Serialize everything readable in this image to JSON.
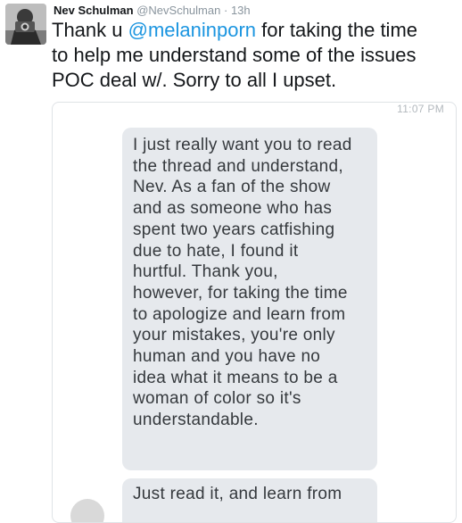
{
  "tweet": {
    "author_name": "Nev Schulman",
    "author_handle": "@NevSchulman",
    "separator": "·",
    "timestamp": "13h",
    "text_before_mention": "Thank u ",
    "mention": "@melaninporn",
    "text_line1_after": " for taking the time",
    "text_line2": "to help me understand some of the issues",
    "text_line3": "POC deal w/. Sorry to all I upset."
  },
  "screenshot": {
    "time": "11:07 PM",
    "message1_lines": [
      "I just really want you to read",
      "the thread and understand,",
      "Nev. As a fan of the show",
      "and as someone who has",
      "spent two years catfishing",
      "due to hate, I found it",
      "hurtful. Thank you,",
      "however, for taking the time",
      "to apologize and learn from",
      "your mistakes, you're only",
      "human and you have no",
      "idea what it means to be a",
      "woman of color so it's",
      "understandable."
    ],
    "message2_lines": [
      "Just read it, and learn from"
    ]
  }
}
